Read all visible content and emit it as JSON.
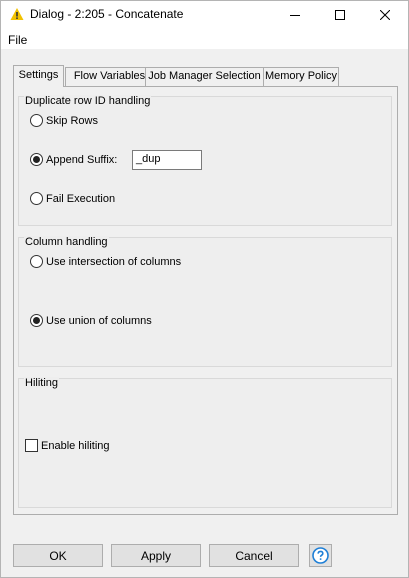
{
  "window": {
    "title": "Dialog - 2:205 - Concatenate",
    "icon": "warning-triangle-icon",
    "controls": [
      "minimize-icon",
      "maximize-icon",
      "close-icon"
    ]
  },
  "menu": {
    "file": "File"
  },
  "tabs": [
    {
      "label": "Settings",
      "active": true
    },
    {
      "label": "Flow Variables",
      "active": false
    },
    {
      "label": "Job Manager Selection",
      "active": false
    },
    {
      "label": "Memory Policy",
      "active": false
    }
  ],
  "duplicate_group": {
    "title": "Duplicate row ID handling",
    "skip_rows": "Skip Rows",
    "append_suffix": "Append Suffix:",
    "suffix_value": "_dup",
    "fail_execution": "Fail Execution",
    "selected": "append_suffix"
  },
  "column_group": {
    "title": "Column handling",
    "intersection": "Use intersection of columns",
    "union": "Use union of columns",
    "selected": "union"
  },
  "hiliting_group": {
    "title": "Hiliting",
    "enable": "Enable hiliting",
    "checked": false
  },
  "buttons": {
    "ok": "OK",
    "apply": "Apply",
    "cancel": "Cancel",
    "help_icon": "help-icon"
  },
  "colors": {
    "accent": "#1e7fd6",
    "warning_icon": "#f2c200"
  }
}
